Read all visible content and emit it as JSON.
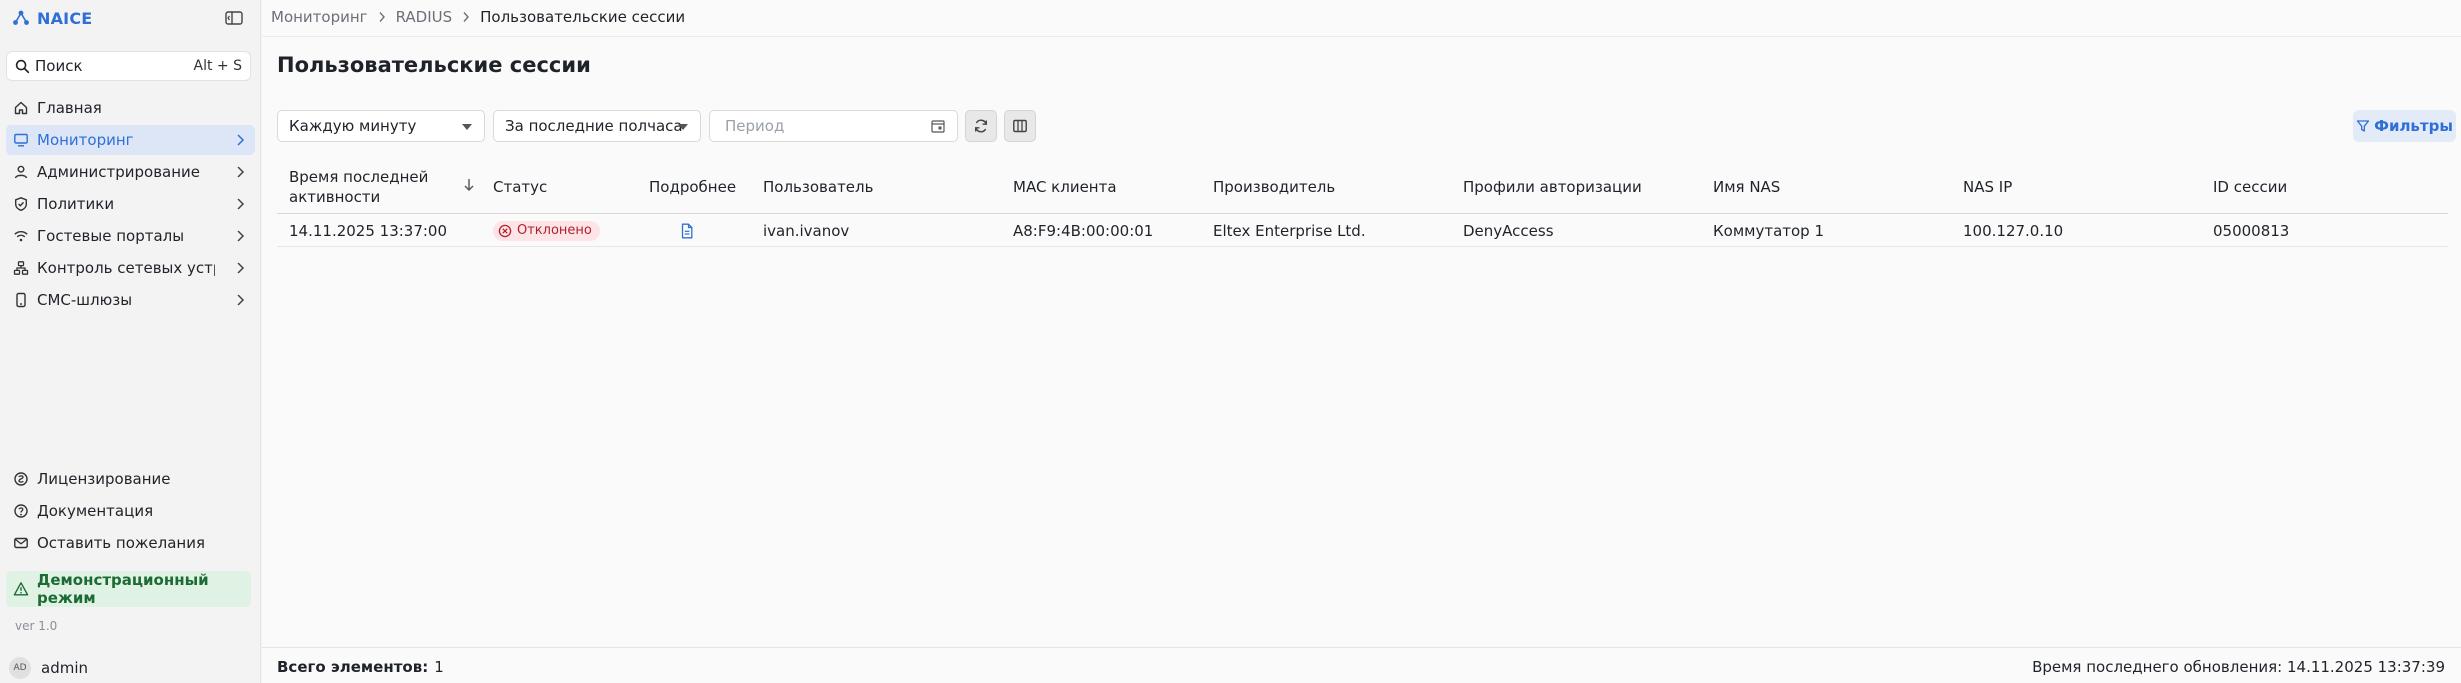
{
  "app": {
    "name": "NAICE",
    "version": "ver 1.0"
  },
  "search": {
    "label": "Поиск",
    "shortcut": "Alt + S"
  },
  "sidebar": {
    "items": [
      {
        "label": "Главная",
        "icon": "home-icon"
      },
      {
        "label": "Мониторинг",
        "icon": "monitor-icon",
        "active": true
      },
      {
        "label": "Администрирование",
        "icon": "user-icon"
      },
      {
        "label": "Политики",
        "icon": "shield-check-icon"
      },
      {
        "label": "Гостевые порталы",
        "icon": "wifi-icon"
      },
      {
        "label": "Контроль сетевых устро...",
        "icon": "network-icon"
      },
      {
        "label": "СМС-шлюзы",
        "icon": "phone-icon"
      }
    ],
    "bottom": [
      {
        "label": "Лицензирование",
        "icon": "license-icon"
      },
      {
        "label": "Документация",
        "icon": "help-icon"
      },
      {
        "label": "Оставить пожелания",
        "icon": "mail-icon"
      }
    ],
    "demo_mode": "Демонстрационный режим"
  },
  "user": {
    "initials": "AD",
    "name": "admin"
  },
  "breadcrumb": [
    "Мониторинг",
    "RADIUS",
    "Пользовательские сессии"
  ],
  "page_title": "Пользовательские сессии",
  "toolbar": {
    "refresh_interval": "Каждую минуту",
    "time_range": "За последние полчаса",
    "period_placeholder": "Период",
    "filters_label": "Фильтры"
  },
  "table": {
    "columns": [
      "Время последней активности",
      "Статус",
      "Подробнее",
      "Пользователь",
      "MAC клиента",
      "Производитель",
      "Профили авторизации",
      "Имя NAS",
      "NAS IP",
      "ID сессии"
    ],
    "rows": [
      {
        "last_activity": "14.11.2025 13:37:00",
        "status": "Отклонено",
        "user": "ivan.ivanov",
        "mac": "A8:F9:4B:00:00:01",
        "vendor": "Eltex Enterprise Ltd.",
        "auth_profiles": "DenyAccess",
        "nas_name": "Коммутатор 1",
        "nas_ip": "100.127.0.10",
        "session_id": "05000813"
      }
    ]
  },
  "footer": {
    "total_label": "Всего элементов:",
    "total_value": "1",
    "last_update": "Время последнего обновления: 14.11.2025 13:37:39"
  },
  "colors": {
    "accent": "#2f6fd6",
    "active_nav_bg": "#dde6f7",
    "demo_bg": "#dff2e3",
    "demo_text": "#1d6b34",
    "rejected_bg": "#fde4e6",
    "rejected_text": "#b3202c"
  }
}
